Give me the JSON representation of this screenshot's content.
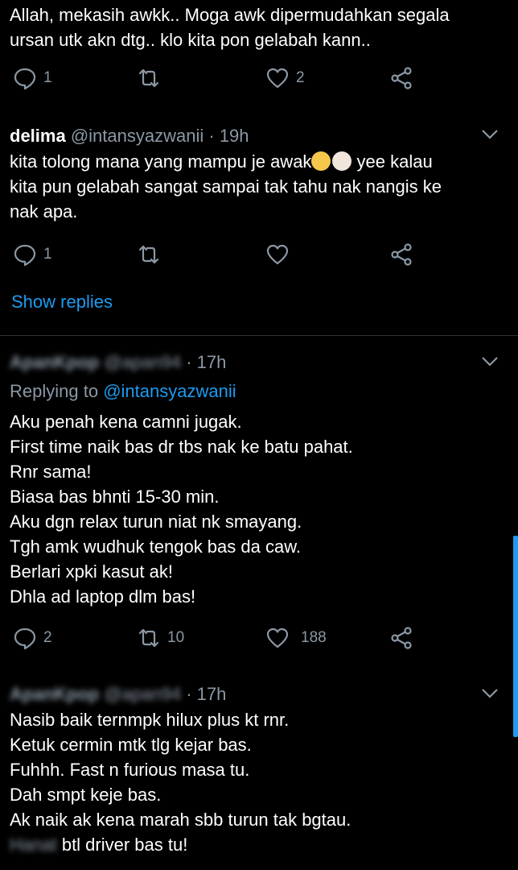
{
  "tweet0": {
    "lines": [
      "Allah, mekasih awkk.. Moga awk dipermudahkan segala",
      "ursan utk akn dtg.. klo kita pon gelabah kann.."
    ],
    "reply_count": "1",
    "retweet_count": "",
    "like_count": "2"
  },
  "tweet1": {
    "name": "delima",
    "handle": "@intansyazwanii",
    "time": "· 19h",
    "line1_before": "kita tolong mana yang mampu je awak",
    "line1_after": " yee kalau",
    "line2": "kita pun gelabah sangat sampai tak tahu nak nangis ke",
    "line3": "nak apa.",
    "reply_count": "1",
    "show_replies": "Show replies"
  },
  "tweet2": {
    "name": "ApanKpop",
    "handle": "@apan94",
    "time": "· 17h",
    "replying_prefix": "Replying to ",
    "replying_to": "@intansyazwanii",
    "lines": [
      "Aku penah kena camni jugak.",
      "First time naik bas dr tbs nak ke batu pahat.",
      "Rnr sama!",
      "Biasa bas bhnti 15-30 min.",
      "Aku dgn relax turun niat nk smayang.",
      "Tgh amk wudhuk tengok bas da caw.",
      "Berlari xpki kasut ak!",
      "Dhla ad laptop dlm bas!"
    ],
    "reply_count": "2",
    "retweet_count": "10",
    "like_count": "188"
  },
  "tweet3": {
    "name": "ApanKpop",
    "handle": "@apan94",
    "time": "· 17h",
    "lines": [
      "Nasib baik ternmpk hilux plus kt rnr.",
      "Ketuk cermin mtk tlg kejar bas.",
      "Fuhhh. Fast n furious masa tu.",
      "Dah smpt keje bas.",
      "Ak naik ak kena marah sbb turun tak bgtau."
    ],
    "last_blurred": "Hanat",
    "last_rest": " btl driver bas tu!"
  },
  "icons": {
    "reply": "reply-icon",
    "retweet": "retweet-icon",
    "like": "heart-icon",
    "share": "share-icon",
    "more": "chevron-down-icon"
  },
  "colors": {
    "link": "#1d9bf0",
    "muted": "#8b98a5",
    "background": "#000000"
  }
}
